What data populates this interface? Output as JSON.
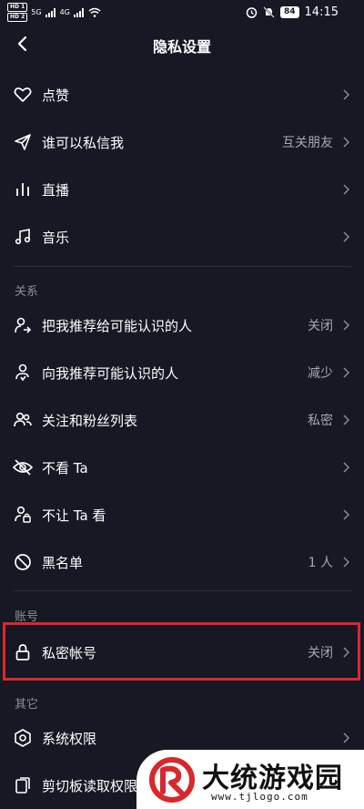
{
  "status_bar": {
    "hd1": "HD 1",
    "hd2": "HD 2",
    "net1": "5G",
    "net2": "4G",
    "battery": "84",
    "time": "14:15"
  },
  "header": {
    "title": "隐私设置"
  },
  "items_top": [
    {
      "label": "点赞",
      "value": ""
    },
    {
      "label": "谁可以私信我",
      "value": "互关朋友"
    },
    {
      "label": "直播",
      "value": ""
    },
    {
      "label": "音乐",
      "value": ""
    }
  ],
  "section_relations": {
    "label": "关系"
  },
  "items_relations": [
    {
      "label": "把我推荐给可能认识的人",
      "value": "关闭"
    },
    {
      "label": "向我推荐可能认识的人",
      "value": "减少"
    },
    {
      "label": "关注和粉丝列表",
      "value": "私密"
    },
    {
      "label": "不看 Ta",
      "value": ""
    },
    {
      "label": "不让 Ta 看",
      "value": ""
    },
    {
      "label": "黑名单",
      "value": "1 人"
    }
  ],
  "section_account": {
    "label": "账号"
  },
  "items_account": [
    {
      "label": "私密帐号",
      "value": "关闭"
    }
  ],
  "section_other": {
    "label": "其它"
  },
  "items_other": [
    {
      "label": "系统权限",
      "value": ""
    },
    {
      "label": "剪切板读取权限",
      "value": ""
    }
  ],
  "watermark": {
    "title": "大统游戏园",
    "url": "www.tjlogo.com"
  },
  "colors": {
    "background": "#161823",
    "highlight": "#e0262d",
    "secondary_text": "#a8a9ad"
  }
}
